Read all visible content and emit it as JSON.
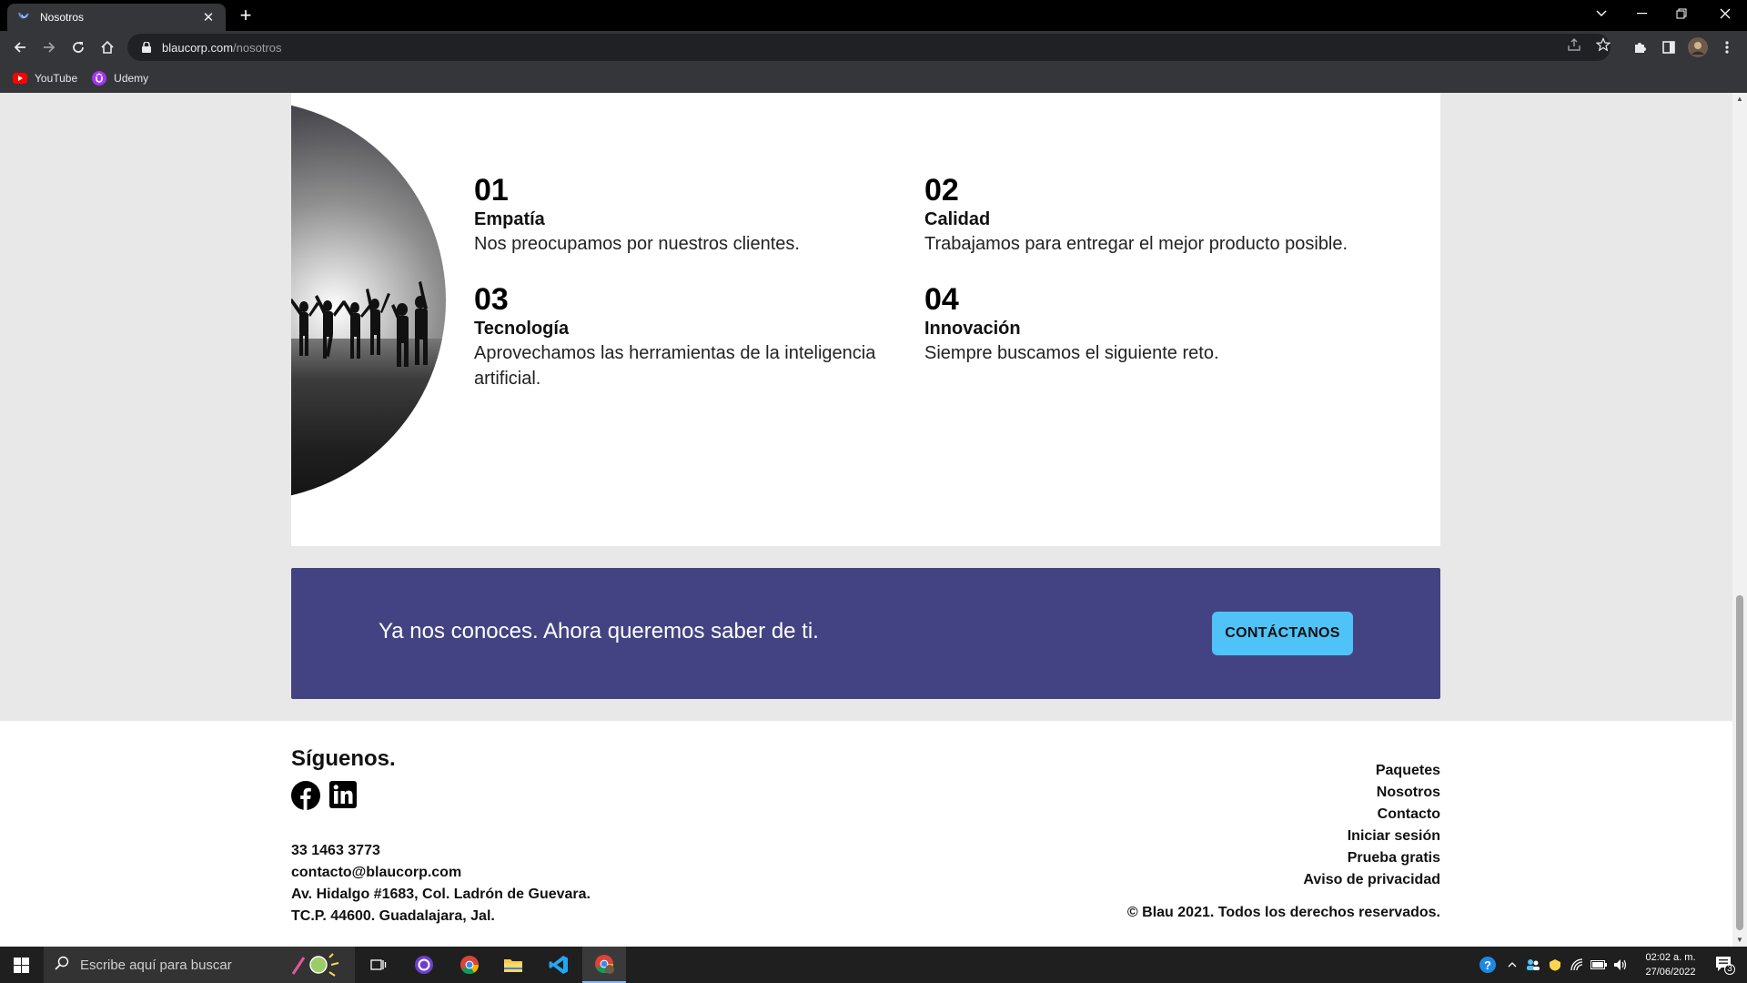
{
  "browser": {
    "tab_title": "Nosotros",
    "close_glyph": "✕",
    "new_tab_glyph": "+",
    "url_host": "blaucorp.com",
    "url_path": "/nosotros",
    "bookmarks": [
      {
        "label": "YouTube",
        "icon": "youtube-icon"
      },
      {
        "label": "Udemy",
        "icon": "udemy-icon"
      }
    ]
  },
  "values": [
    {
      "number": "01",
      "title": "Empatía",
      "description": "Nos preocupamos por nuestros clientes."
    },
    {
      "number": "02",
      "title": "Calidad",
      "description": "Trabajamos para entregar el mejor producto posible."
    },
    {
      "number": "03",
      "title": "Tecnología",
      "description": "Aprovechamos las herramientas de la inteligencia artificial."
    },
    {
      "number": "04",
      "title": "Innovación",
      "description": "Siempre buscamos el siguiente reto."
    }
  ],
  "cta": {
    "text": "Ya nos conoces. Ahora queremos saber de ti.",
    "button": "CONTÁCTANOS",
    "background_color": "#434383",
    "button_color": "#4fc3f7"
  },
  "footer": {
    "follow_title": "Síguenos.",
    "social": [
      "facebook-icon",
      "linkedin-icon"
    ],
    "phone": "33 1463 3773",
    "email": "contacto@blaucorp.com",
    "address_line1": "Av. Hidalgo #1683, Col. Ladrón de Guevara.",
    "address_line2": "TC.P. 44600. Guadalajara, Jal.",
    "links": [
      "Paquetes",
      "Nosotros",
      "Contacto",
      "Iniciar sesión",
      "Prueba gratis",
      "Aviso de privacidad"
    ],
    "copyright": "© Blau 2021. Todos los derechos reservados."
  },
  "taskbar": {
    "search_placeholder": "Escribe aquí para buscar",
    "time": "02:02 a. m.",
    "date": "27/06/2022",
    "notification_count": "3"
  }
}
